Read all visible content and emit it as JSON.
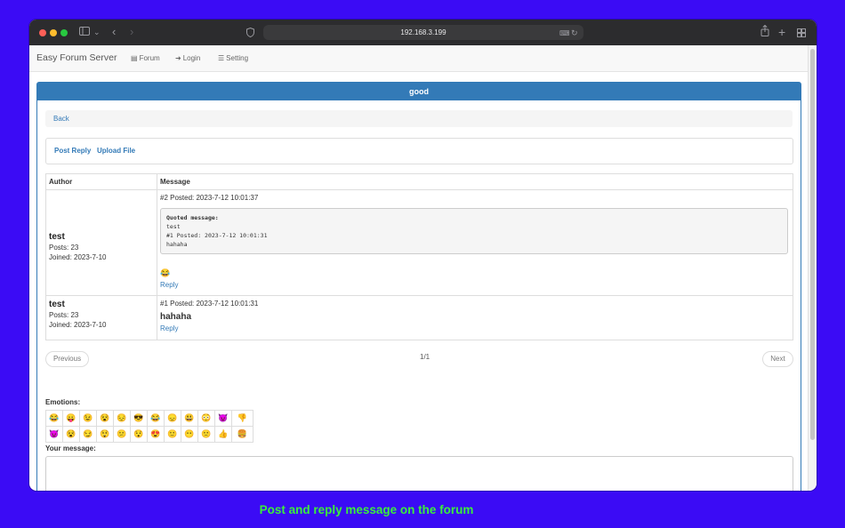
{
  "browser": {
    "url": "192.168.3.199",
    "colors": {
      "close": "#ff5f57",
      "minimize": "#febc2e",
      "maximize": "#28c840"
    },
    "icons": [
      "sidebar-icon",
      "chevron-down-icon",
      "back-arrow-icon",
      "forward-arrow-icon",
      "shield-icon",
      "translate-icon",
      "reload-icon",
      "share-icon",
      "new-tab-icon",
      "tab-overview-icon"
    ]
  },
  "navbar": {
    "brand": "Easy Forum Server",
    "links": [
      {
        "label": "Forum",
        "icon": "list-icon"
      },
      {
        "label": "Login",
        "icon": "login-icon"
      },
      {
        "label": "Setting",
        "icon": "menu-icon"
      }
    ]
  },
  "topic": {
    "title": "good",
    "back_label": "Back",
    "post_reply_label": "Post Reply",
    "upload_file_label": "Upload File",
    "accent": "#337ab7"
  },
  "table": {
    "headers": {
      "author": "Author",
      "message": "Message"
    },
    "posts": [
      {
        "author": "test",
        "posts": "Posts: 23",
        "joined": "Joined: 2023-7-10",
        "posted": "#2 Posted: 2023-7-12 10:01:37",
        "quote_title": "Quoted message:",
        "quote_lines": "test\n#1 Posted: 2023-7-12 10:01:31\nhahaha",
        "body": "😂",
        "reply": "Reply"
      },
      {
        "author": "test",
        "posts": "Posts: 23",
        "joined": "Joined: 2023-7-10",
        "posted": "#1 Posted: 2023-7-12 10:01:31",
        "body": "hahaha",
        "reply": "Reply"
      }
    ]
  },
  "pager": {
    "previous": "Previous",
    "page": "1/1",
    "next": "Next"
  },
  "emotions": {
    "label": "Emotions:",
    "rows": [
      [
        "😂",
        "😛",
        "😉",
        "😵",
        "😔",
        "😎",
        "😂",
        "😞",
        "😃",
        "😳",
        "😈",
        "👎"
      ],
      [
        "😈",
        "😵",
        "😏",
        "😲",
        "😕",
        "😯",
        "😍",
        "🙂",
        "😶",
        "🙁",
        "👍",
        "🍔"
      ]
    ]
  },
  "message_label": "Your message:",
  "caption": "Post and reply message on the forum"
}
